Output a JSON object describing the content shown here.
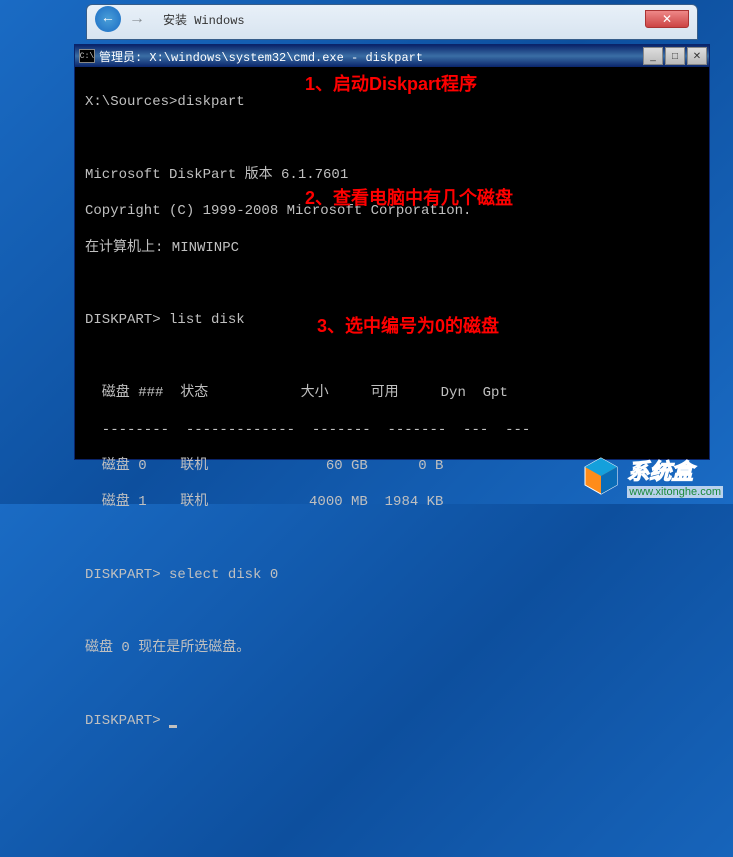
{
  "installer": {
    "title": "安装 Windows"
  },
  "cmd": {
    "title": "管理员: X:\\windows\\system32\\cmd.exe - diskpart",
    "line_prompt1": "X:\\Sources>diskpart",
    "line_version": "Microsoft DiskPart 版本 6.1.7601",
    "line_copyright": "Copyright (C) 1999-2008 Microsoft Corporation.",
    "line_computer": "在计算机上: MINWINPC",
    "line_listdisk": "DISKPART> list disk",
    "table_header": "  磁盘 ###  状态           大小     可用     Dyn  Gpt",
    "table_divider": "  --------  -------------  -------  -------  ---  ---",
    "table_row0": "  磁盘 0    联机              60 GB      0 B",
    "table_row1": "  磁盘 1    联机            4000 MB  1984 KB",
    "line_select": "DISKPART> select disk 0",
    "line_selected": "磁盘 0 现在是所选磁盘。",
    "line_prompt2": "DISKPART> "
  },
  "annotations": {
    "a1": "1、启动Diskpart程序",
    "a2": "2、查看电脑中有几个磁盘",
    "a3": "3、选中编号为0的磁盘"
  },
  "watermark": {
    "title": "系统盒",
    "url": "www.xitonghe.com"
  }
}
